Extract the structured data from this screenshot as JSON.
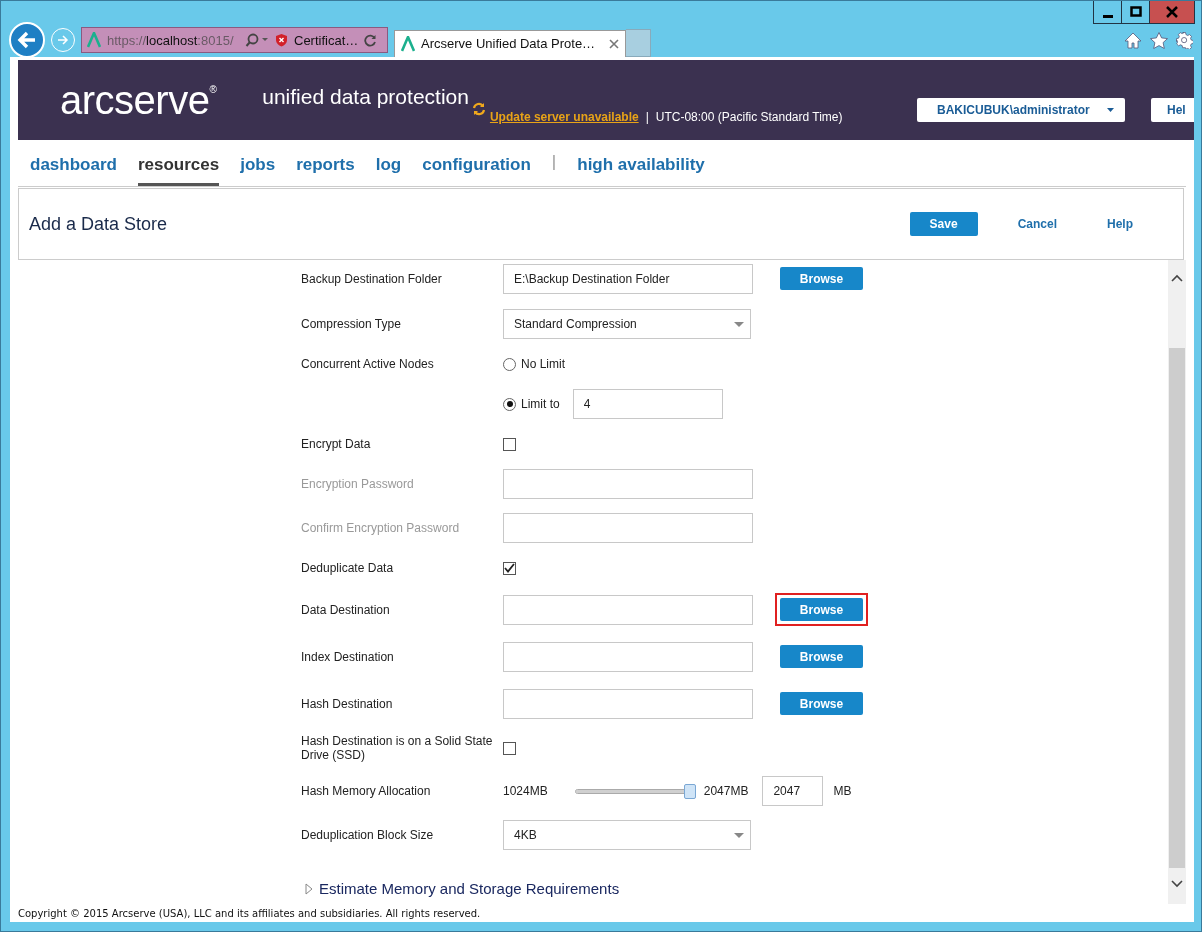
{
  "browser": {
    "address": {
      "scheme": "https://",
      "host": "localhost",
      "rest": ":8015/"
    },
    "cert_error": "Certificat…",
    "tab_title": "Arcserve Unified Data Prote…"
  },
  "header": {
    "logo": "arcserve",
    "logo_mark": "®",
    "product": "unified data protection",
    "update_link": "Update server unavailable",
    "divider": "|",
    "timezone": "UTC-08:00 (Pacific Standard Time)",
    "user": "BAKICUBUK\\administrator",
    "help": "Hel"
  },
  "nav": [
    {
      "kind": "link",
      "label": "dashboard",
      "selected": false
    },
    {
      "kind": "link",
      "label": "resources",
      "selected": true
    },
    {
      "kind": "link",
      "label": "jobs",
      "selected": false
    },
    {
      "kind": "link",
      "label": "reports",
      "selected": false
    },
    {
      "kind": "link",
      "label": "log",
      "selected": false
    },
    {
      "kind": "link",
      "label": "configuration",
      "selected": false
    },
    {
      "kind": "separator",
      "label": "|"
    },
    {
      "kind": "link",
      "label": "high availability",
      "selected": false
    }
  ],
  "panel": {
    "title": "Add a Data Store",
    "save": "Save",
    "cancel": "Cancel",
    "help": "Help"
  },
  "fields": [
    {
      "kind": "path",
      "label": "Backup Destination Folder",
      "value": "E:\\Backup Destination Folder",
      "button": "Browse",
      "highlighted": false
    },
    {
      "kind": "select",
      "label": "Compression Type",
      "value": "Standard Compression"
    },
    {
      "kind": "radio",
      "label": "Concurrent Active Nodes",
      "options": [
        {
          "label": "No Limit",
          "selected": false
        },
        {
          "label": "Limit to",
          "selected": true,
          "value": "4"
        }
      ]
    },
    {
      "kind": "checkbox",
      "label": "Encrypt Data",
      "checked": false
    },
    {
      "kind": "text",
      "label": "Encryption Password",
      "disabled": true
    },
    {
      "kind": "text",
      "label": "Confirm Encryption Password",
      "disabled": true
    },
    {
      "kind": "checkbox",
      "label": "Deduplicate Data",
      "checked": true
    },
    {
      "kind": "path",
      "label": "Data Destination",
      "button": "Browse",
      "highlighted": true
    },
    {
      "kind": "path",
      "label": "Index Destination",
      "button": "Browse",
      "highlighted": false
    },
    {
      "kind": "path",
      "label": "Hash Destination",
      "button": "Browse",
      "highlighted": false
    },
    {
      "kind": "checkbox",
      "label": "Hash Destination is on a Solid State Drive (SSD)",
      "checked": false
    },
    {
      "kind": "slider",
      "label": "Hash Memory Allocation",
      "min_label": "1024MB",
      "max_label": "2047MB",
      "level": 1,
      "value": "2047",
      "unit": "MB"
    },
    {
      "kind": "select",
      "label": "Deduplication Block Size",
      "value": "4KB"
    }
  ],
  "estimate": "Estimate Memory and Storage Requirements",
  "copyright": "Copyright © 2015 Arcserve (USA), LLC and its affiliates and subsidiaries. All rights reserved."
}
